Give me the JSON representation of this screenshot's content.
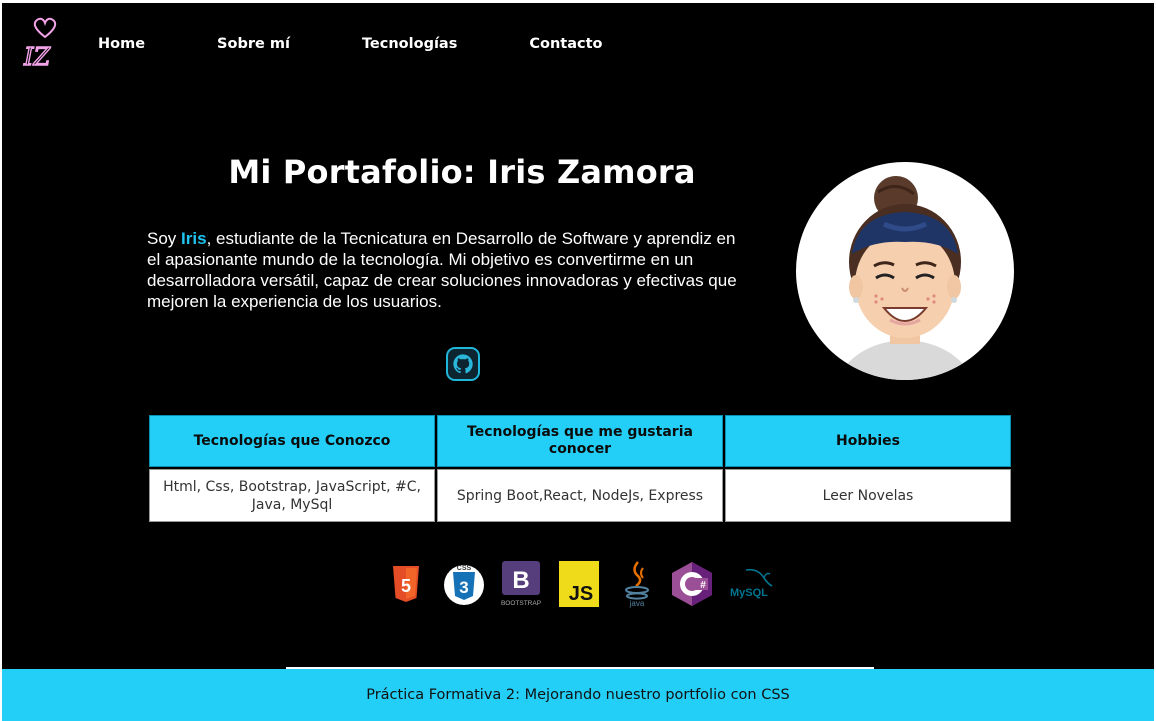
{
  "logo": {
    "text": "IZ"
  },
  "nav": {
    "items": [
      {
        "label": "Home"
      },
      {
        "label": "Sobre mí"
      },
      {
        "label": "Tecnologías"
      },
      {
        "label": "Contacto"
      }
    ]
  },
  "hero": {
    "title": "Mi Portafolio: Iris Zamora",
    "intro_prefix": "Soy ",
    "intro_name": "Iris",
    "intro_rest": ", estudiante de la Tecnicatura en Desarrollo de Software y aprendiz en el apasionante mundo de la tecnología. Mi objetivo es convertirme en un desarrolladora versátil, capaz de crear soluciones innovadoras y efectivas que mejoren la experiencia de los usuarios."
  },
  "table": {
    "headers": [
      "Tecnologías que Conozco",
      "Tecnologías que me gustaria conocer",
      "Hobbies"
    ],
    "row": [
      "Html, Css, Bootstrap, JavaScript, #C, Java, MySql",
      "Spring Boot,React, NodeJs, Express",
      "Leer Novelas"
    ]
  },
  "tech_icons": {
    "html5": {
      "label": "5"
    },
    "css3": {
      "label": "3",
      "tag": "CSS"
    },
    "bootstrap": {
      "label": "B",
      "sub": "BOOTSTRAP"
    },
    "javascript": {
      "label": "JS"
    },
    "java": {
      "label": "java"
    },
    "csharp": {
      "label": "C#"
    },
    "mysql": {
      "label": "MySQL"
    }
  },
  "footer": {
    "text": "Práctica Formativa 2: Mejorando nuestro portfolio con CSS"
  },
  "colors": {
    "accent": "#23cff7",
    "highlight": "#1fc3f0",
    "logo_pink": "#f3a3e8",
    "background": "#000000"
  }
}
